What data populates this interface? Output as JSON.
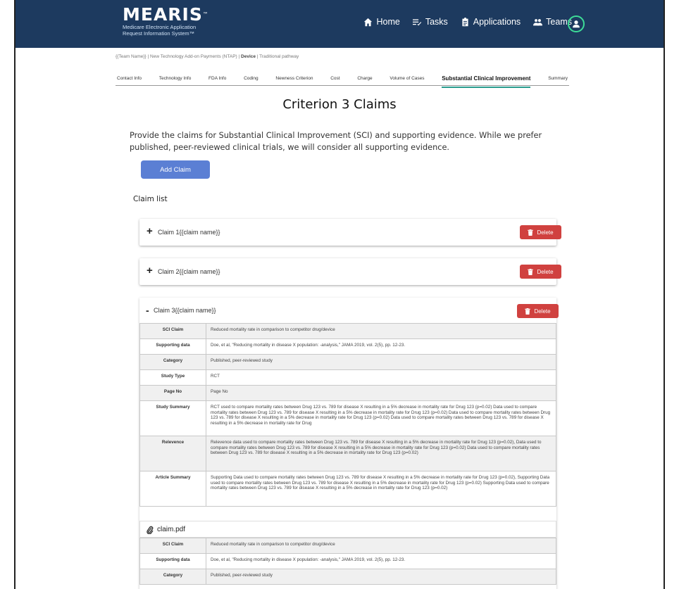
{
  "header": {
    "logo_word": "MEARIS",
    "logo_tm": "™",
    "logo_sub_1": "Medicare Electronic Application",
    "logo_sub_2": "Request Information System™",
    "nav": [
      {
        "label": "Home",
        "icon": "home-icon"
      },
      {
        "label": "Tasks",
        "icon": "tasks-icon"
      },
      {
        "label": "Applications",
        "icon": "clipboard-icon"
      },
      {
        "label": "Teams",
        "icon": "team-icon"
      }
    ],
    "user_icon": "user-icon",
    "colors": {
      "bar": "#1d3a5f",
      "accent": "#3ddc97"
    }
  },
  "breadcrumb": {
    "prefix": "{{Team Name}} | New Technology Add-on Payments (NTAP) | ",
    "bold": "Device",
    "suffix": " | Traditional pathway"
  },
  "tabs": [
    "Contact Info",
    "Technology Info",
    "FDA Info",
    "Coding",
    "Newness Criterion",
    "Cost",
    "Charge",
    "Volume of Cases",
    "Substantial Clinical Improvement",
    "Summary"
  ],
  "active_tab": "Substantial Clinical Improvement",
  "main": {
    "title": "Criterion 3 Claims",
    "intro": "Provide the claims for Substantial Clinical Improvement (SCI) and supporting evidence. While we prefer published, peer-reviewed clinical trials, we will consider all supporting evidence.",
    "add_button": "Add Claim",
    "claim_list_label": "Claim list",
    "delete_label": "Delete",
    "claims": [
      {
        "toggle": "+",
        "label": "Claim 1{{claim name}}"
      },
      {
        "toggle": "+",
        "label": "Claim 2{{claim name}}"
      },
      {
        "toggle": "-",
        "label": "Claim 3{{claim name}}"
      }
    ],
    "table_rows": [
      {
        "k": "SCI Claim",
        "v": "Reduced mortality rate in comparison to competitor drug/device"
      },
      {
        "k": "Supporting data",
        "v": "Doe, et al, \"Reducing mortality in disease X population: -analysis,\" JAMA 2019, vol. 2(5), pp. 12-23."
      },
      {
        "k": "Category",
        "v": "Published, peer-reviewed study"
      },
      {
        "k": "Study Type",
        "v": "RCT"
      },
      {
        "k": "Page No",
        "v": "Page No"
      },
      {
        "k": "Study Summary",
        "v": "RCT used to compare mortality rates between Drug 123 vs. 789 for disease X resulting in a 5% decrease in mortality rate for Drug 123 (p=0.02) Data used to compare mortality rates between Drug 123 vs. 789 for disease X resulting in a 5% decrease in mortality rate for Drug 123 (p=0.02) Data used to compare mortality rates between Drug 123 vs. 789 for disease X resulting in a 5% decrease in mortality rate for Drug 123 (p=0.02)  Data used to compare mortality rates between Drug 123 vs. 789 for disease X resulting in a 5% decrease in mortality rate for Drug"
      },
      {
        "k": "Relevence",
        "v": "Relevence data  used to compare mortality rates between Drug 123 vs. 789 for disease X resulting in a 5% decrease in mortality rate for Drug 123 (p=0.02), Data used to compare mortality rates between Drug 123 vs. 789 for disease X resulting in a 5% decrease in mortality rate for Drug 123 (p=0.02) Data used to compare mortality rates between Drug 123 vs. 789 for disease X resulting in a 5% decrease in mortality rate for Drug 123 (p=0.02)"
      },
      {
        "k": "Article Summary",
        "v": "Supporting Data used to compare mortality rates between Drug 123 vs. 789 for disease X resulting in a 5% decrease in mortality rate for Drug 123 (p=0.02), Supporting Data used to compare mortality rates between Drug 123 vs. 789 for disease X resulting in a 5% decrease in mortality rate for Drug 123 (p=0.02) Supporting Data used to compare mortality rates between Drug 123 vs. 789 for disease X resulting in a 5% decrease in mortality rate for Drug 123 (p=0.02)"
      }
    ],
    "attachment": "claim.pdf",
    "table_rows_2": [
      {
        "k": "SCI Claim",
        "v": "Reduced mortality rate in comparison to competitor drug/device"
      },
      {
        "k": "Supporting data",
        "v": "Doe, et al, \"Reducing mortality in disease X population: -analysis,\" JAMA 2019, vol. 2(5), pp. 12-23."
      },
      {
        "k": "Category",
        "v": "Published, peer-reviewed study"
      }
    ],
    "colors": {
      "add": "#5b7fd4",
      "delete": "#d0413f",
      "active_tab": "#2a9d8f"
    }
  }
}
